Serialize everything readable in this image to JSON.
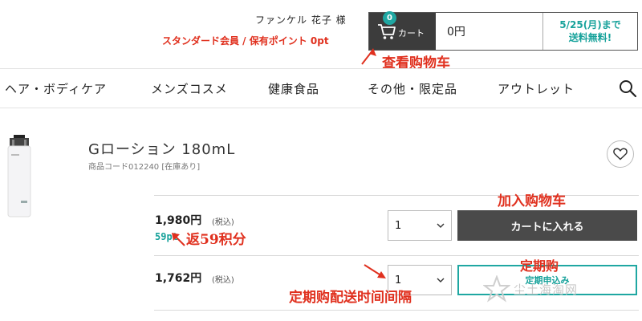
{
  "header": {
    "user_name": "ファンケル 花子 様",
    "member_info": "スタンダード会員 / 保有ポイント 0pt",
    "cart": {
      "label": "カート",
      "count": "0",
      "amount": "0円",
      "shipping_line1": "5/25(月)まで",
      "shipping_line2": "送料無料!"
    }
  },
  "nav": {
    "items": [
      "ヘア・ボディケア",
      "メンズコスメ",
      "健康食品",
      "その他・限定品",
      "アウトレット"
    ],
    "search_icon": "search-icon"
  },
  "product": {
    "name": "Gローション 180mL",
    "code": "商品コード012240 [在庫あり]",
    "price_regular": "1,980円",
    "tax_label": "(税込)",
    "points": "59pt",
    "price_subscription": "1,762円",
    "qty_regular": "1",
    "qty_subscription": "1",
    "add_to_cart_label": "カートに入れる",
    "subscribe_label": "定期申込み",
    "favorite_icon": "heart-icon"
  },
  "annotations": {
    "view_cart": "查看购物车",
    "add_to_cart": "加入购物车",
    "points_back": "返59积分",
    "subscription": "定期购",
    "delivery_interval": "定期购配送时间间隔"
  },
  "watermark": "尘土海淘网",
  "colors": {
    "accent_teal": "#1fa7a2",
    "annotation_red": "#e0301e",
    "dark_button": "#4a4a4a"
  }
}
